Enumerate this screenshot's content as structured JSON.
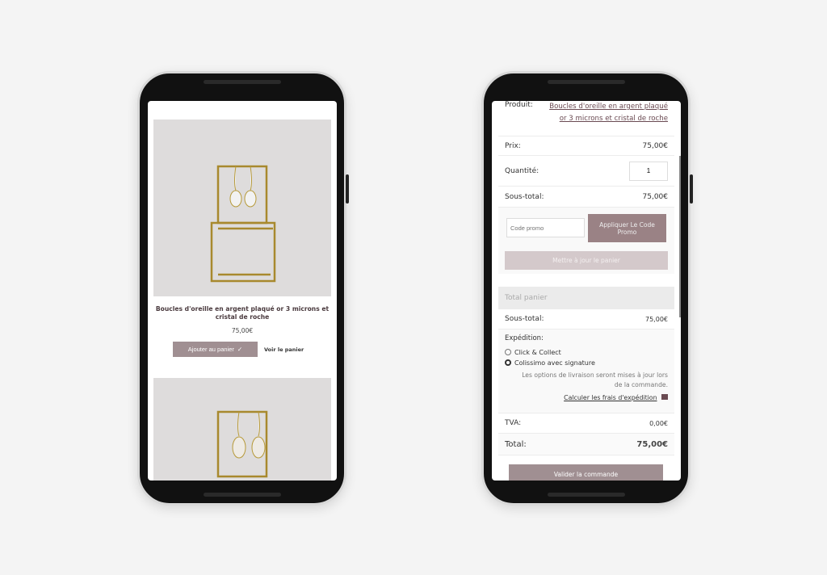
{
  "product_page": {
    "title": "Boucles d'oreille en argent plaqué or 3 microns et cristal de roche",
    "price": "75,00€",
    "add_to_cart": "Ajouter au panier",
    "add_icon": "check-icon",
    "view_cart": "Voir le panier"
  },
  "cart_page": {
    "product_label": "Produit:",
    "product_name": "Boucles d'oreille en argent plaqué or 3 microns et cristal de roche",
    "price_label": "Prix:",
    "price": "75,00€",
    "qty_label": "Quantité:",
    "qty": "1",
    "subtotal_label": "Sous-total:",
    "subtotal": "75,00€",
    "promo_placeholder": "Code promo",
    "apply_promo": "Appliquer Le Code Promo",
    "update_cart": "Mettre à jour le panier",
    "totals_title": "Total panier",
    "totals_subtotal_label": "Sous-total:",
    "totals_subtotal": "75,00€",
    "shipping_label": "Expédition:",
    "shipping_options": [
      {
        "label": "Click & Collect",
        "selected": false
      },
      {
        "label": "Colissimo avec signature",
        "selected": true
      }
    ],
    "shipping_note": "Les options de livraison seront mises à jour lors de la commande.",
    "calc_shipping": "Calculer les frais d'expédition",
    "calc_icon": "truck-icon",
    "tva_label": "TVA:",
    "tva": "0,00€",
    "total_label": "Total:",
    "total": "75,00€",
    "checkout": "Valider la commande"
  },
  "colors": {
    "accent": "#a08f92",
    "accent_dark": "#9a8285",
    "accent_light": "#d4c9cb"
  }
}
